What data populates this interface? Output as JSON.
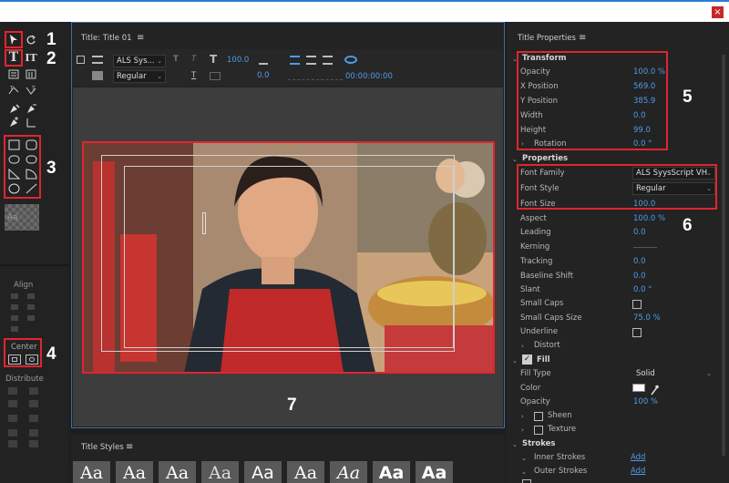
{
  "window": {
    "close_glyph": "×"
  },
  "callouts": {
    "n1": "1",
    "n2": "2",
    "n3": "3",
    "n4": "4",
    "n5": "5",
    "n6": "6",
    "n7": "7"
  },
  "tools": {
    "select_icon": "arrow-select-icon",
    "rotate_icon": "rotate-icon",
    "type_glyph": "T",
    "vertical_type_glyph": "IT",
    "align_label": "Align",
    "center_label": "Center",
    "distribute_label": "Distribute",
    "style_swatch": "Aa"
  },
  "editor": {
    "title": "Title: Title 01",
    "menu_glyph": "≡",
    "font_family": "ALS Sys...",
    "font_style": "Regular",
    "font_size": "100.0",
    "kerning_value": "0.0",
    "timecode": "00:00:00:00"
  },
  "title_styles": {
    "title": "Title Styles",
    "menu_glyph": "≡",
    "swatches": [
      "Aa",
      "Aa",
      "Aa",
      "Aa",
      "Aa",
      "Aa",
      "Aa",
      "Aa",
      "Aa"
    ]
  },
  "props": {
    "title": "Title Properties",
    "menu_glyph": "≡",
    "transform": {
      "label": "Transform",
      "opacity": {
        "label": "Opacity",
        "value": "100.0 %"
      },
      "x": {
        "label": "X Position",
        "value": "569.0"
      },
      "y": {
        "label": "Y Position",
        "value": "385.9"
      },
      "width": {
        "label": "Width",
        "value": "0.0"
      },
      "height": {
        "label": "Height",
        "value": "99.0"
      },
      "rotation": {
        "label": "Rotation",
        "value": "0.0 °"
      }
    },
    "properties": {
      "label": "Properties",
      "font_family": {
        "label": "Font Family",
        "value": "ALS SyysScript VH"
      },
      "font_style": {
        "label": "Font Style",
        "value": "Regular"
      },
      "font_size": {
        "label": "Font Size",
        "value": "100.0"
      },
      "aspect": {
        "label": "Aspect",
        "value": "100.0 %"
      },
      "leading": {
        "label": "Leading",
        "value": "0.0"
      },
      "kerning": {
        "label": "Kerning",
        "value": ""
      },
      "tracking": {
        "label": "Tracking",
        "value": "0.0"
      },
      "baseline": {
        "label": "Baseline Shift",
        "value": "0.0"
      },
      "slant": {
        "label": "Slant",
        "value": "0.0 °"
      },
      "small_caps": {
        "label": "Small Caps"
      },
      "small_caps_size": {
        "label": "Small Caps Size",
        "value": "75.0 %"
      },
      "underline": {
        "label": "Underline"
      },
      "distort": {
        "label": "Distort"
      }
    },
    "fill": {
      "label": "Fill",
      "fill_type": {
        "label": "Fill Type",
        "value": "Solid"
      },
      "color": {
        "label": "Color",
        "hex": "#ffffff"
      },
      "opacity": {
        "label": "Opacity",
        "value": "100 %"
      },
      "sheen": {
        "label": "Sheen"
      },
      "texture": {
        "label": "Texture"
      }
    },
    "strokes": {
      "label": "Strokes",
      "inner": {
        "label": "Inner Strokes",
        "add": "Add"
      },
      "outer": {
        "label": "Outer Strokes",
        "add": "Add"
      }
    }
  },
  "colors": {
    "accent_value": "#4d9ce6",
    "callout": "#e0252f"
  }
}
